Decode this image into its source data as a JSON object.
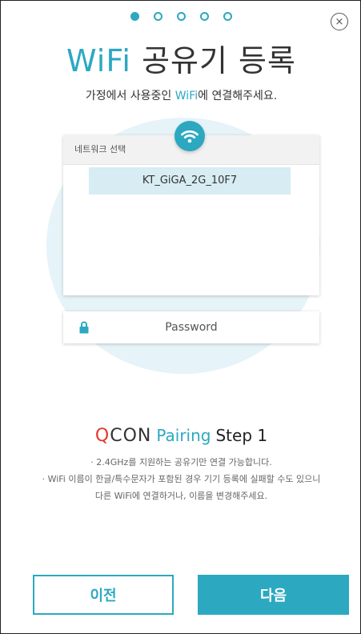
{
  "pager": {
    "total": 5,
    "active": 1
  },
  "close_label": "×",
  "title": {
    "accent": "WiFi",
    "rest": " 공유기 등록"
  },
  "subtitle": {
    "before": "가정에서 사용중인 ",
    "accent": "WiFi",
    "after": "에 연결해주세요."
  },
  "network": {
    "header": "네트워크 선택",
    "items": [
      "KT_GiGA_2G_10F7"
    ]
  },
  "password": {
    "placeholder": "Password",
    "value": ""
  },
  "brand": {
    "logo_q": "Q",
    "logo_rest": "CON",
    "pairing": "Pairing",
    "step": "Step 1"
  },
  "notes": [
    "· 2.4GHz를 지원하는 공유기만 연결 가능합니다.",
    "· WiFi 이름이 한글/특수문자가 포함된 경우 기기 등록에 실패할 수도 있으니",
    "다른 WiFi에 연결하거나, 이름을 변경해주세요."
  ],
  "buttons": {
    "prev": "이전",
    "next": "다음"
  },
  "colors": {
    "accent": "#2ca8c1",
    "logo_red": "#e23a2d",
    "circle_bg": "#e6f3f8"
  },
  "icons": {
    "close": "close-icon",
    "wifi": "wifi-icon",
    "lock": "lock-icon"
  }
}
